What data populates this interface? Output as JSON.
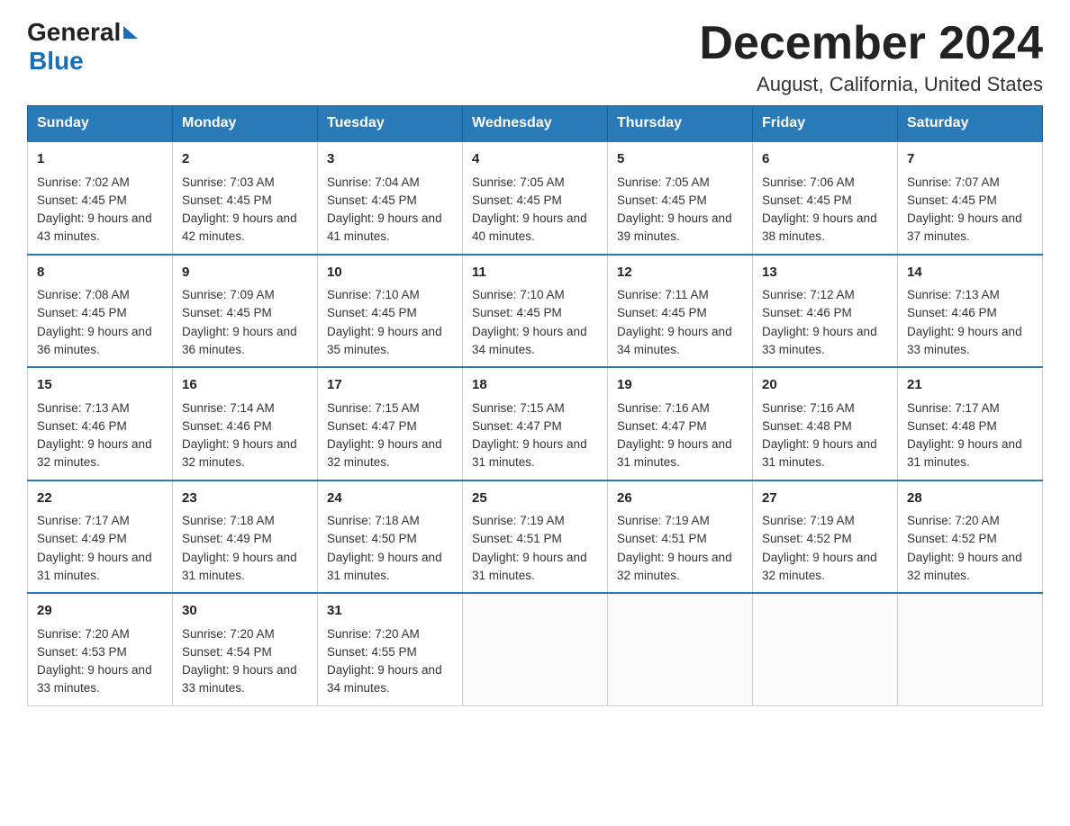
{
  "header": {
    "logo_general": "General",
    "logo_blue": "Blue",
    "main_title": "December 2024",
    "subtitle": "August, California, United States"
  },
  "days_header": [
    "Sunday",
    "Monday",
    "Tuesday",
    "Wednesday",
    "Thursday",
    "Friday",
    "Saturday"
  ],
  "weeks": [
    [
      {
        "num": "1",
        "sunrise": "7:02 AM",
        "sunset": "4:45 PM",
        "daylight": "9 hours and 43 minutes."
      },
      {
        "num": "2",
        "sunrise": "7:03 AM",
        "sunset": "4:45 PM",
        "daylight": "9 hours and 42 minutes."
      },
      {
        "num": "3",
        "sunrise": "7:04 AM",
        "sunset": "4:45 PM",
        "daylight": "9 hours and 41 minutes."
      },
      {
        "num": "4",
        "sunrise": "7:05 AM",
        "sunset": "4:45 PM",
        "daylight": "9 hours and 40 minutes."
      },
      {
        "num": "5",
        "sunrise": "7:05 AM",
        "sunset": "4:45 PM",
        "daylight": "9 hours and 39 minutes."
      },
      {
        "num": "6",
        "sunrise": "7:06 AM",
        "sunset": "4:45 PM",
        "daylight": "9 hours and 38 minutes."
      },
      {
        "num": "7",
        "sunrise": "7:07 AM",
        "sunset": "4:45 PM",
        "daylight": "9 hours and 37 minutes."
      }
    ],
    [
      {
        "num": "8",
        "sunrise": "7:08 AM",
        "sunset": "4:45 PM",
        "daylight": "9 hours and 36 minutes."
      },
      {
        "num": "9",
        "sunrise": "7:09 AM",
        "sunset": "4:45 PM",
        "daylight": "9 hours and 36 minutes."
      },
      {
        "num": "10",
        "sunrise": "7:10 AM",
        "sunset": "4:45 PM",
        "daylight": "9 hours and 35 minutes."
      },
      {
        "num": "11",
        "sunrise": "7:10 AM",
        "sunset": "4:45 PM",
        "daylight": "9 hours and 34 minutes."
      },
      {
        "num": "12",
        "sunrise": "7:11 AM",
        "sunset": "4:45 PM",
        "daylight": "9 hours and 34 minutes."
      },
      {
        "num": "13",
        "sunrise": "7:12 AM",
        "sunset": "4:46 PM",
        "daylight": "9 hours and 33 minutes."
      },
      {
        "num": "14",
        "sunrise": "7:13 AM",
        "sunset": "4:46 PM",
        "daylight": "9 hours and 33 minutes."
      }
    ],
    [
      {
        "num": "15",
        "sunrise": "7:13 AM",
        "sunset": "4:46 PM",
        "daylight": "9 hours and 32 minutes."
      },
      {
        "num": "16",
        "sunrise": "7:14 AM",
        "sunset": "4:46 PM",
        "daylight": "9 hours and 32 minutes."
      },
      {
        "num": "17",
        "sunrise": "7:15 AM",
        "sunset": "4:47 PM",
        "daylight": "9 hours and 32 minutes."
      },
      {
        "num": "18",
        "sunrise": "7:15 AM",
        "sunset": "4:47 PM",
        "daylight": "9 hours and 31 minutes."
      },
      {
        "num": "19",
        "sunrise": "7:16 AM",
        "sunset": "4:47 PM",
        "daylight": "9 hours and 31 minutes."
      },
      {
        "num": "20",
        "sunrise": "7:16 AM",
        "sunset": "4:48 PM",
        "daylight": "9 hours and 31 minutes."
      },
      {
        "num": "21",
        "sunrise": "7:17 AM",
        "sunset": "4:48 PM",
        "daylight": "9 hours and 31 minutes."
      }
    ],
    [
      {
        "num": "22",
        "sunrise": "7:17 AM",
        "sunset": "4:49 PM",
        "daylight": "9 hours and 31 minutes."
      },
      {
        "num": "23",
        "sunrise": "7:18 AM",
        "sunset": "4:49 PM",
        "daylight": "9 hours and 31 minutes."
      },
      {
        "num": "24",
        "sunrise": "7:18 AM",
        "sunset": "4:50 PM",
        "daylight": "9 hours and 31 minutes."
      },
      {
        "num": "25",
        "sunrise": "7:19 AM",
        "sunset": "4:51 PM",
        "daylight": "9 hours and 31 minutes."
      },
      {
        "num": "26",
        "sunrise": "7:19 AM",
        "sunset": "4:51 PM",
        "daylight": "9 hours and 32 minutes."
      },
      {
        "num": "27",
        "sunrise": "7:19 AM",
        "sunset": "4:52 PM",
        "daylight": "9 hours and 32 minutes."
      },
      {
        "num": "28",
        "sunrise": "7:20 AM",
        "sunset": "4:52 PM",
        "daylight": "9 hours and 32 minutes."
      }
    ],
    [
      {
        "num": "29",
        "sunrise": "7:20 AM",
        "sunset": "4:53 PM",
        "daylight": "9 hours and 33 minutes."
      },
      {
        "num": "30",
        "sunrise": "7:20 AM",
        "sunset": "4:54 PM",
        "daylight": "9 hours and 33 minutes."
      },
      {
        "num": "31",
        "sunrise": "7:20 AM",
        "sunset": "4:55 PM",
        "daylight": "9 hours and 34 minutes."
      },
      null,
      null,
      null,
      null
    ]
  ]
}
